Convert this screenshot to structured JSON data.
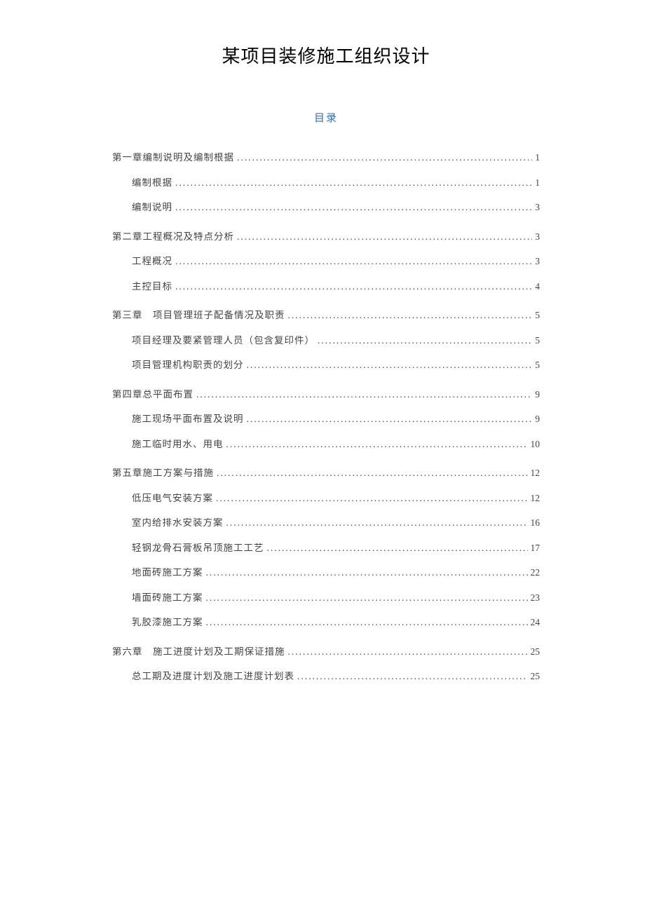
{
  "title": "某项目装修施工组织设计",
  "toc_heading": "目录",
  "toc": [
    {
      "level": 1,
      "label": "第一章编制说明及编制根据",
      "page": "1"
    },
    {
      "level": 2,
      "label": "编制根据",
      "page": "1"
    },
    {
      "level": 2,
      "label": "编制说明",
      "page": "3"
    },
    {
      "level": 1,
      "label": "第二章工程概况及特点分析",
      "page": "3"
    },
    {
      "level": 2,
      "label": "工程概况",
      "page": "3"
    },
    {
      "level": 2,
      "label": "主控目标",
      "page": "4"
    },
    {
      "level": 1,
      "label": "第三章　项目管理班子配备情况及职责",
      "page": "5"
    },
    {
      "level": 2,
      "label": "项目经理及要紧管理人员（包含复印件）",
      "page": "5"
    },
    {
      "level": 2,
      "label": "项目管理机构职责的划分",
      "page": "5"
    },
    {
      "level": 1,
      "label": "第四章总平面布置",
      "page": "9"
    },
    {
      "level": 2,
      "label": "施工现场平面布置及说明",
      "page": "9"
    },
    {
      "level": 2,
      "label": "施工临时用水、用电",
      "page": "10"
    },
    {
      "level": 1,
      "label": "第五章施工方案与措施",
      "page": "12"
    },
    {
      "level": 2,
      "label": "低压电气安装方案",
      "page": "12"
    },
    {
      "level": 2,
      "label": "室内给排水安装方案",
      "page": "16"
    },
    {
      "level": 2,
      "label": "轻钢龙骨石膏板吊顶施工工艺",
      "page": "17"
    },
    {
      "level": 2,
      "label": "地面砖施工方案",
      "page": "22"
    },
    {
      "level": 2,
      "label": "墙面砖施工方案",
      "page": "23"
    },
    {
      "level": 2,
      "label": "乳胶漆施工方案",
      "page": "24"
    },
    {
      "level": 1,
      "label": "第六章　施工进度计划及工期保证措施",
      "page": "25"
    },
    {
      "level": 2,
      "label": "总工期及进度计划及施工进度计划表",
      "page": "25"
    }
  ]
}
